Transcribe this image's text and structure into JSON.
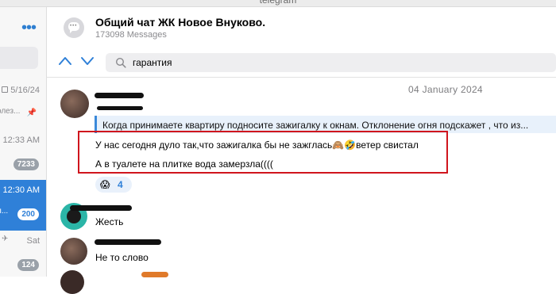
{
  "window": {
    "title": "telegram"
  },
  "sidebar": {
    "items": [
      {
        "time": "5/16/24",
        "snippet": "олез..."
      },
      {
        "time": "12:33 AM",
        "badge": "7233"
      },
      {
        "time": "12:30 AM",
        "snippet": "л...",
        "badge": "200",
        "active": true
      },
      {
        "time": "Sat",
        "badge": "124"
      }
    ]
  },
  "chat": {
    "title": "Общий чат ЖК Новое Внуково.",
    "subtitle": "173098 Messages"
  },
  "search": {
    "query": "гарантия"
  },
  "messages": {
    "date": "04 January 2024",
    "quote": "Когда принимаете квартиру подносите зажигалку к окнам. Отклонение огня подскажет , что из...",
    "line1": "У нас сегодня дуло так,что зажигалка бы не зажглась🙈🤣ветер свистал",
    "line2": "А в туалете на плитке вода замерзла((((",
    "reaction": {
      "emoji": "😱",
      "count": "4"
    },
    "msg2": "Жесть",
    "msg3": "Не то слово"
  },
  "colors": {
    "accent": "#2f80d8",
    "highlight_border": "#d0151d",
    "badge": "#9aa1a9"
  }
}
